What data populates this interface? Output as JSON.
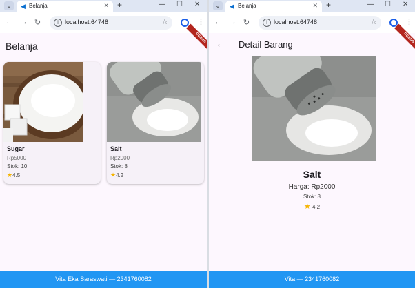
{
  "left": {
    "browser": {
      "tab_title": "Belanja",
      "url": "localhost:64748"
    },
    "app": {
      "title": "Belanja",
      "debug_label": "DEBUG",
      "products": [
        {
          "name": "Sugar",
          "price": "Rp5000",
          "stock": "Stok: 10",
          "rating": "4.5"
        },
        {
          "name": "Salt",
          "price": "Rp2000",
          "stock": "Stok: 8",
          "rating": "4.2"
        }
      ],
      "footer": "Vita Eka Saraswati — 2341760082"
    }
  },
  "right": {
    "browser": {
      "tab_title": "Belanja",
      "url": "localhost:64748"
    },
    "app": {
      "title": "Detail Barang",
      "debug_label": "DEBUG",
      "product": {
        "name": "Salt",
        "price": "Harga: Rp2000",
        "stock": "Stok: 8",
        "rating": "4.2"
      },
      "footer": "Vita — 2341760082"
    }
  },
  "icons": {
    "tab_dropdown": "chevron-down-icon",
    "flutter": "flutter-icon",
    "close": "close-icon",
    "new_tab": "plus-icon",
    "back": "arrow-left-icon",
    "forward": "arrow-right-icon",
    "reload": "reload-icon",
    "info": "info-icon",
    "bookmark": "star-icon",
    "profile": "profile-icon",
    "menu": "kebab-icon",
    "rating": "star-icon"
  },
  "colors": {
    "footer": "#2196f3",
    "background": "#fdf7fe",
    "debug_banner": "#b3261e",
    "rating_star": "#f5b400"
  }
}
